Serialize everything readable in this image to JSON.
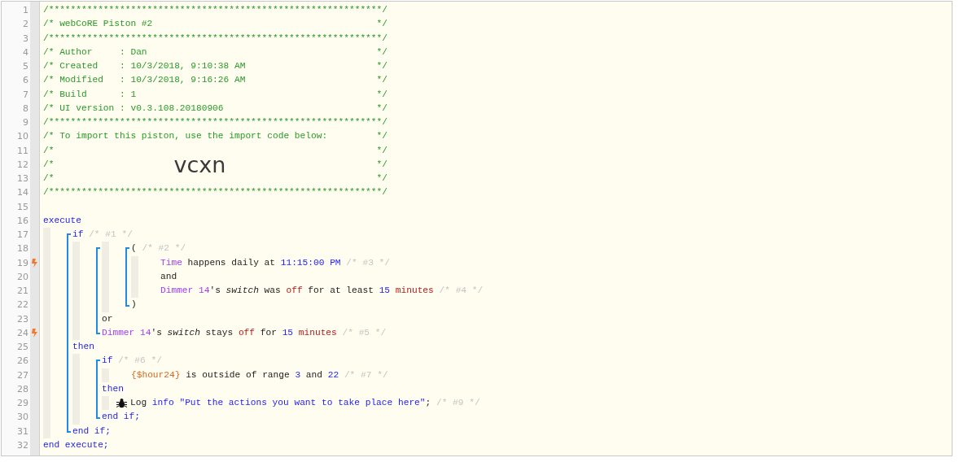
{
  "script": {
    "items": [
      {
        "number": "1",
        "tokens": [
          {
            "kind": "comment",
            "text": "/*************************************************************/"
          }
        ]
      },
      {
        "number": "2",
        "tokens": [
          {
            "kind": "comment",
            "text": "/* webCoRE Piston #2"
          },
          {
            "kind": "close",
            "text": "*/"
          }
        ]
      },
      {
        "number": "3",
        "tokens": [
          {
            "kind": "comment",
            "text": "/*************************************************************/"
          }
        ]
      },
      {
        "number": "4",
        "tokens": [
          {
            "kind": "comment",
            "text": "/* Author     : Dan"
          },
          {
            "kind": "close",
            "text": "*/"
          }
        ]
      },
      {
        "number": "5",
        "tokens": [
          {
            "kind": "comment",
            "text": "/* Created    : 10/3/2018, 9:10:38 AM"
          },
          {
            "kind": "close",
            "text": "*/"
          }
        ]
      },
      {
        "number": "6",
        "tokens": [
          {
            "kind": "comment",
            "text": "/* Modified   : 10/3/2018, 9:16:26 AM"
          },
          {
            "kind": "close",
            "text": "*/"
          }
        ]
      },
      {
        "number": "7",
        "tokens": [
          {
            "kind": "comment",
            "text": "/* Build      : 1"
          },
          {
            "kind": "close",
            "text": "*/"
          }
        ]
      },
      {
        "number": "8",
        "tokens": [
          {
            "kind": "comment",
            "text": "/* UI version : v0.3.108.20180906"
          },
          {
            "kind": "close",
            "text": "*/"
          }
        ]
      },
      {
        "number": "9",
        "tokens": [
          {
            "kind": "comment",
            "text": "/*************************************************************/"
          }
        ]
      },
      {
        "number": "10",
        "tokens": [
          {
            "kind": "comment",
            "text": "/* To import this piston, use the import code below:"
          },
          {
            "kind": "close",
            "text": "*/"
          }
        ]
      },
      {
        "number": "11",
        "tokens": [
          {
            "kind": "comment",
            "text": "/*"
          },
          {
            "kind": "close",
            "text": "*/"
          }
        ]
      },
      {
        "number": "12",
        "tokens": [
          {
            "kind": "comment",
            "text": "/*"
          },
          {
            "kind": "code",
            "text": "vcxn"
          },
          {
            "kind": "close",
            "text": "*/"
          }
        ]
      },
      {
        "number": "13",
        "tokens": [
          {
            "kind": "comment",
            "text": "/*"
          },
          {
            "kind": "close",
            "text": "*/"
          }
        ]
      },
      {
        "number": "14",
        "tokens": [
          {
            "kind": "comment",
            "text": "/*************************************************************/"
          }
        ]
      },
      {
        "number": "15"
      },
      {
        "number": "16",
        "tokens": [
          {
            "kind": "keyword",
            "text": "execute"
          }
        ]
      },
      {
        "bar": true,
        "items": [
          {
            "bracket": true,
            "items": [
              {
                "number": "17",
                "tokens": [
                  {
                    "kind": "keyword",
                    "text": "if"
                  },
                  {
                    "kind": "note",
                    "text": " /* #1 */"
                  }
                ]
              },
              {
                "bar": true,
                "items": [
                  {
                    "bracket": true,
                    "items": [
                      {
                        "bar": true,
                        "items": [
                          {
                            "bracket": true,
                            "items": [
                              {
                                "number": "18",
                                "tokens": [
                                  {
                                    "kind": "text",
                                    "text": "("
                                  },
                                  {
                                    "kind": "note",
                                    "text": " /* #2 */"
                                  }
                                ]
                              },
                              {
                                "bar": true,
                                "items": [
                                  {
                                    "number": "19",
                                    "trigger": true,
                                    "tokens": [
                                      {
                                        "kind": "device",
                                        "text": "Time"
                                      },
                                      {
                                        "kind": "text",
                                        "text": " happens daily at "
                                      },
                                      {
                                        "kind": "value",
                                        "text": "11:15:00 PM"
                                      },
                                      {
                                        "kind": "note",
                                        "text": " /* #3 */"
                                      }
                                    ]
                                  },
                                  {
                                    "number": "20",
                                    "tokens": [
                                      {
                                        "kind": "text",
                                        "text": "and"
                                      }
                                    ]
                                  },
                                  {
                                    "number": "21",
                                    "tokens": [
                                      {
                                        "kind": "device",
                                        "text": "Dimmer 14"
                                      },
                                      {
                                        "kind": "text",
                                        "text": "'s "
                                      },
                                      {
                                        "kind": "attribute",
                                        "text": "switch"
                                      },
                                      {
                                        "kind": "text",
                                        "text": " was "
                                      },
                                      {
                                        "kind": "unit",
                                        "text": "off"
                                      },
                                      {
                                        "kind": "text",
                                        "text": " for at least "
                                      },
                                      {
                                        "kind": "value",
                                        "text": "15"
                                      },
                                      {
                                        "kind": "unit",
                                        "text": " minutes"
                                      },
                                      {
                                        "kind": "note",
                                        "text": " /* #4 */"
                                      }
                                    ]
                                  }
                                ]
                              },
                              {
                                "number": "22",
                                "tokens": [
                                  {
                                    "kind": "text",
                                    "text": ")"
                                  }
                                ]
                              }
                            ]
                          }
                        ]
                      },
                      {
                        "number": "23",
                        "tokens": [
                          {
                            "kind": "text",
                            "text": "or"
                          }
                        ]
                      },
                      {
                        "number": "24",
                        "trigger": true,
                        "tokens": [
                          {
                            "kind": "device",
                            "text": "Dimmer 14"
                          },
                          {
                            "kind": "text",
                            "text": "'s "
                          },
                          {
                            "kind": "attribute",
                            "text": "switch"
                          },
                          {
                            "kind": "text",
                            "text": " stays "
                          },
                          {
                            "kind": "unit",
                            "text": "off"
                          },
                          {
                            "kind": "text",
                            "text": " for "
                          },
                          {
                            "kind": "value",
                            "text": "15"
                          },
                          {
                            "kind": "unit",
                            "text": " minutes"
                          },
                          {
                            "kind": "note",
                            "text": " /* #5 */"
                          }
                        ]
                      }
                    ]
                  }
                ]
              },
              {
                "number": "25",
                "tokens": [
                  {
                    "kind": "keyword",
                    "text": "then"
                  }
                ]
              },
              {
                "bar": true,
                "items": [
                  {
                    "bracket": true,
                    "items": [
                      {
                        "number": "26",
                        "tokens": [
                          {
                            "kind": "keyword",
                            "text": "if"
                          },
                          {
                            "kind": "note",
                            "text": " /* #6 */"
                          }
                        ]
                      },
                      {
                        "bar": true,
                        "items": [
                          {
                            "number": "27",
                            "tokens": [
                              {
                                "kind": "variable",
                                "text": "{$hour24}"
                              },
                              {
                                "kind": "text",
                                "text": " is outside of range "
                              },
                              {
                                "kind": "value",
                                "text": "3"
                              },
                              {
                                "kind": "text",
                                "text": " and "
                              },
                              {
                                "kind": "value",
                                "text": "22"
                              },
                              {
                                "kind": "note",
                                "text": " /* #7 */"
                              }
                            ]
                          }
                        ]
                      },
                      {
                        "number": "28",
                        "tokens": [
                          {
                            "kind": "keyword",
                            "text": "then"
                          }
                        ]
                      },
                      {
                        "bar": true,
                        "items": [
                          {
                            "number": "29",
                            "kind": "action",
                            "tokens": [
                              {
                                "kind": "text",
                                "text": "Log "
                              },
                              {
                                "kind": "value",
                                "text": "info"
                              },
                              {
                                "kind": "value",
                                "text": " \"Put the actions you want to take place here\""
                              },
                              {
                                "kind": "text",
                                "text": ";"
                              },
                              {
                                "kind": "note",
                                "text": " /* #9 */"
                              }
                            ]
                          }
                        ]
                      },
                      {
                        "number": "30",
                        "tokens": [
                          {
                            "kind": "keyword",
                            "text": "end if;"
                          }
                        ]
                      }
                    ]
                  }
                ]
              },
              {
                "number": "31",
                "tokens": [
                  {
                    "kind": "keyword",
                    "text": "end if;"
                  }
                ]
              }
            ]
          }
        ]
      },
      {
        "number": "32",
        "tokens": [
          {
            "kind": "keyword",
            "text": "end execute;"
          }
        ]
      }
    ]
  }
}
